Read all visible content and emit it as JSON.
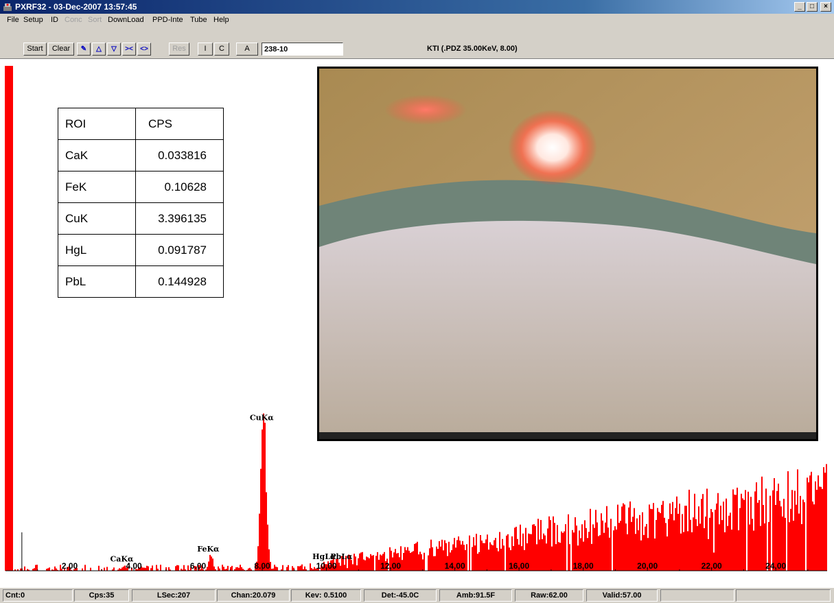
{
  "window": {
    "title": "PXRF32 - 03-Dec-2007 13:57:45",
    "minimize": "_",
    "maximize": "□",
    "close": "×"
  },
  "menu": [
    "File",
    "Setup",
    "ID",
    "Conc",
    "Sort",
    "DownLoad",
    "PPD-Inte",
    "Tube",
    "Help"
  ],
  "toolbar": {
    "start": "Start",
    "clear": "Clear",
    "res": "Res",
    "i": "I",
    "c": "C",
    "a": "A",
    "sample_id": "238-10",
    "instrument": "KTI  (.PDZ 35.00KeV, 8.00)"
  },
  "roi_table": {
    "headers": [
      "ROI",
      "CPS"
    ],
    "rows": [
      [
        "CaK",
        "0.033816"
      ],
      [
        "FeK",
        "0.10628"
      ],
      [
        "CuK",
        "3.396135"
      ],
      [
        "HgL",
        "0.091787"
      ],
      [
        "PbL",
        "0.144928"
      ]
    ]
  },
  "chart_data": {
    "type": "bar",
    "color": "#ff0000",
    "xlim": [
      0,
      25.6
    ],
    "ylim": [
      0,
      100
    ],
    "x_ticks": [
      "2.00",
      "4.00",
      "6.00",
      "8.00",
      "10.00",
      "12.00",
      "14.00",
      "16.00",
      "18.00",
      "20.00",
      "22.00",
      "24.00"
    ],
    "peaks": [
      {
        "label": "CaKα",
        "kev": 3.69,
        "height": 1
      },
      {
        "label": "FeKα",
        "kev": 6.4,
        "height": 3
      },
      {
        "label": "CuKα",
        "kev": 8.04,
        "height": 29
      },
      {
        "label": "HgLα",
        "kev": 9.99,
        "height": 1.5
      },
      {
        "label": "PbLα",
        "kev": 10.55,
        "height": 1.5
      }
    ],
    "cursor_kev": 0.51
  },
  "status": {
    "cnt": "Cnt:0",
    "cps": "Cps:35",
    "lsec": "LSec:207",
    "chan": "Chan:20.079",
    "kev": "Kev: 0.5100",
    "det": "Det:-45.0C",
    "amb": "Amb:91.5F",
    "raw": "Raw:62.00",
    "valid": "Valid:57.00"
  }
}
